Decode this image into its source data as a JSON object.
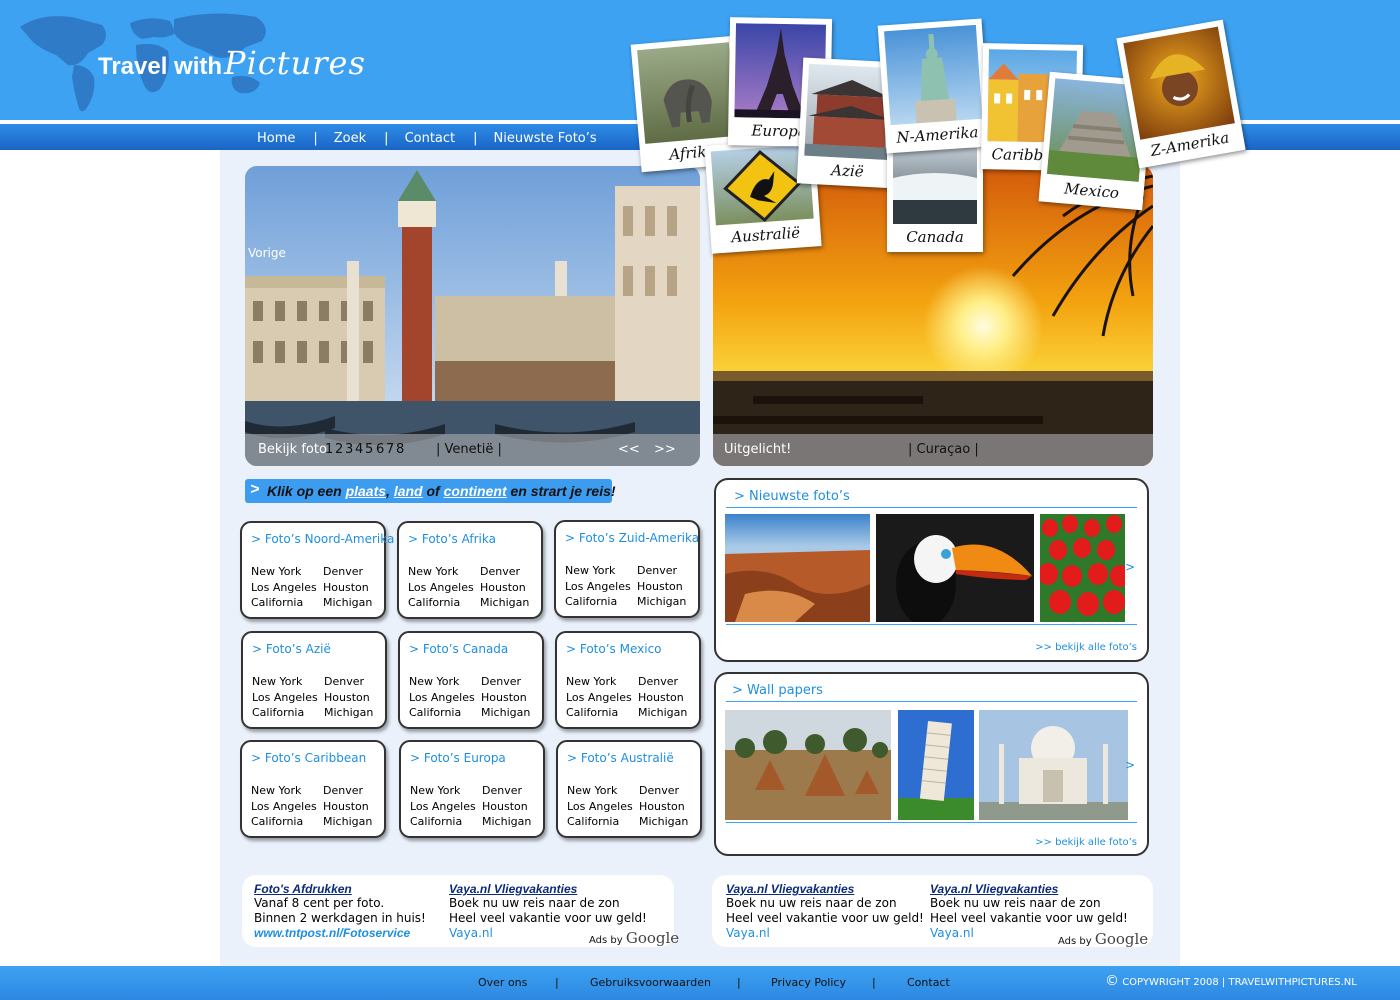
{
  "header": {
    "logo_part1": "Travel with",
    "logo_part2": "Pictures",
    "nav": [
      "Home",
      "Zoek",
      "Contact",
      "Nieuwste Foto’s"
    ],
    "separator": "|",
    "polaroids": [
      "Afrika",
      "Europa",
      "Azië",
      "N-Amerika",
      "Caribbean",
      "Mexico",
      "Z-Amerika",
      "Australië",
      "Canada"
    ]
  },
  "slideshow_left": {
    "prev_label": "Vorige",
    "caption_label": "Bekijk foto",
    "pages": [
      "1",
      "2",
      "3",
      "4",
      "5",
      "6",
      "7",
      "8"
    ],
    "location": "| Venetië |",
    "prev_arrows": "<<",
    "next_arrows": ">>"
  },
  "slideshow_right": {
    "caption_label": "Uitgelicht!",
    "location": "| Curaçao |"
  },
  "banner": {
    "arrow": ">",
    "text1": "Klik op een",
    "link1": "plaats",
    "comma": ",",
    "link2": "land",
    "of": "of",
    "link3": "continent",
    "text2": "en strart je reis!"
  },
  "cards": [
    {
      "title": ">  Foto’s Noord-Amerika",
      "col1": [
        "New York",
        "Los Angeles",
        "California"
      ],
      "col2": [
        "Denver",
        "Houston",
        "Michigan"
      ]
    },
    {
      "title": ">  Foto’s Afrika",
      "col1": [
        "New York",
        "Los Angeles",
        "California"
      ],
      "col2": [
        "Denver",
        "Houston",
        "Michigan"
      ]
    },
    {
      "title": ">  Foto’s Zuid-Amerika",
      "col1": [
        "New York",
        "Los Angeles",
        "California"
      ],
      "col2": [
        "Denver",
        "Houston",
        "Michigan"
      ]
    },
    {
      "title": ">  Foto’s Azië",
      "col1": [
        "New York",
        "Los Angeles",
        "California"
      ],
      "col2": [
        "Denver",
        "Houston",
        "Michigan"
      ]
    },
    {
      "title": ">  Foto’s Canada",
      "col1": [
        "New York",
        "Los Angeles",
        "California"
      ],
      "col2": [
        "Denver",
        "Houston",
        "Michigan"
      ]
    },
    {
      "title": ">  Foto’s Mexico",
      "col1": [
        "New York",
        "Los Angeles",
        "California"
      ],
      "col2": [
        "Denver",
        "Houston",
        "Michigan"
      ]
    },
    {
      "title": ">  Foto’s Caribbean",
      "col1": [
        "New York",
        "Los Angeles",
        "California"
      ],
      "col2": [
        "Denver",
        "Houston",
        "Michigan"
      ]
    },
    {
      "title": ">  Foto’s Europa",
      "col1": [
        "New York",
        "Los Angeles",
        "California"
      ],
      "col2": [
        "Denver",
        "Houston",
        "Michigan"
      ]
    },
    {
      "title": ">  Foto’s Australië",
      "col1": [
        "New York",
        "Los Angeles",
        "California"
      ],
      "col2": [
        "Denver",
        "Houston",
        "Michigan"
      ]
    }
  ],
  "newest_photos": {
    "title": "> Nieuwste foto’s",
    "next": ">",
    "view_all": ">> bekijk alle foto’s"
  },
  "wallpapers": {
    "title": "> Wall papers",
    "next": ">",
    "view_all": ">> bekijk alle foto’s"
  },
  "ads_left": [
    {
      "heading": "Foto's Afdrukken",
      "line1": "Vanaf 8 cent per foto.",
      "line2": "Binnen 2 werkdagen in huis!",
      "url": "www.tntpost.nl/Fotoservice"
    },
    {
      "heading": "Vaya.nl Vliegvakanties",
      "line1": "Boek nu uw reis naar de zon",
      "line2": "Heel veel vakantie voor uw geld!",
      "url": "Vaya.nl"
    }
  ],
  "ads_right": [
    {
      "heading": "Vaya.nl Vliegvakanties",
      "line1": "Boek nu uw reis naar de zon",
      "line2": "Heel veel vakantie voor uw geld!",
      "url": "Vaya.nl"
    },
    {
      "heading": "Vaya.nl Vliegvakanties",
      "line1": "Boek nu uw reis naar de zon",
      "line2": "Heel veel vakantie voor uw geld!",
      "url": "Vaya.nl"
    }
  ],
  "ads_by": "Ads by",
  "google": "Google",
  "footer": {
    "links": [
      "Over ons",
      "Gebruiksvoorwaarden",
      "Privacy Policy",
      "Contact"
    ],
    "separator": "|",
    "copyright_symbol": "©",
    "copyright": "COPYWRIGHT 2008 | TRAVELWITHPICTURES.NL"
  }
}
